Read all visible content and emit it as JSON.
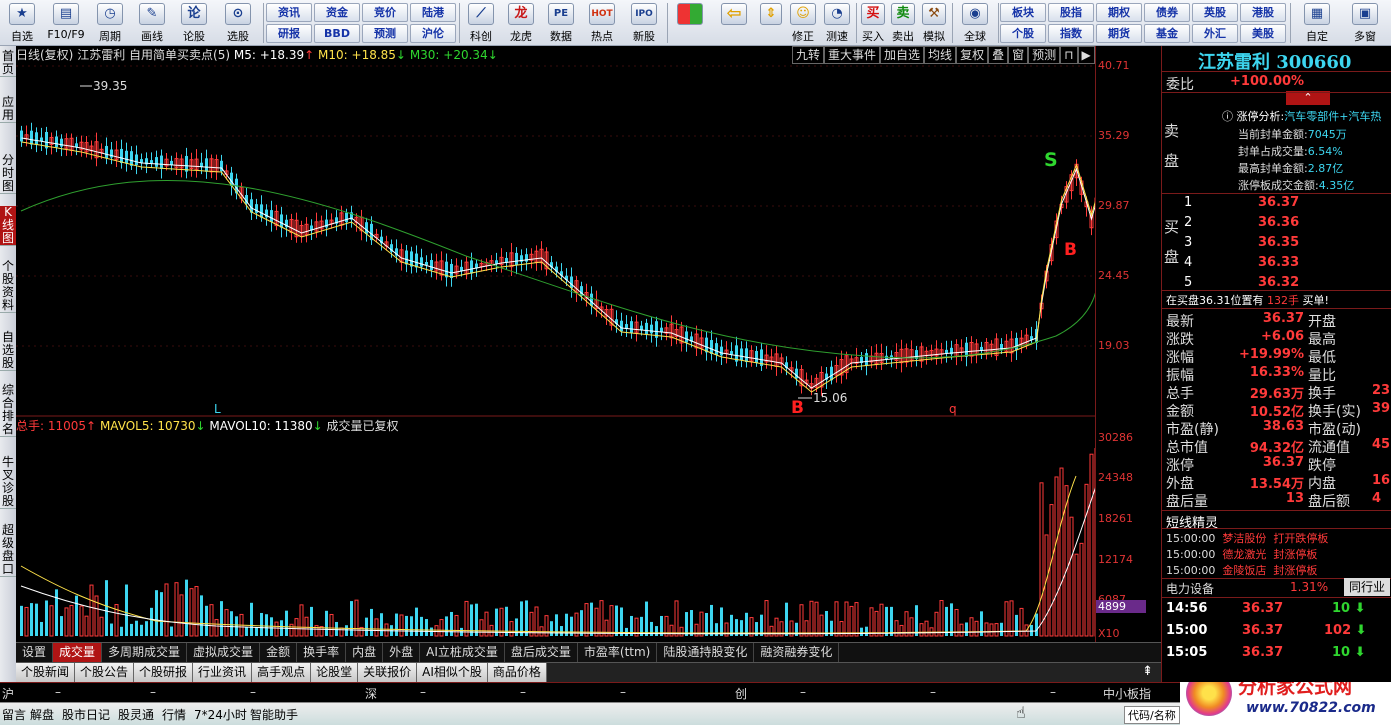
{
  "toolbar": {
    "left": [
      {
        "label": "自选",
        "icon": "star-icon"
      },
      {
        "label": "F10/F9",
        "icon": "f10-icon"
      },
      {
        "label": "周期",
        "icon": "clock-icon"
      },
      {
        "label": "画线",
        "icon": "pencil-icon"
      },
      {
        "label": "论股",
        "icon": "comment-icon"
      },
      {
        "label": "选股",
        "icon": "chart-select-icon"
      }
    ],
    "grid": [
      [
        "资讯",
        "资金",
        "竞价",
        "陆港"
      ],
      [
        "研报",
        "BBD",
        "预测",
        "沪伦"
      ]
    ],
    "mid": [
      {
        "label": "科创",
        "icon": "star-board-icon"
      },
      {
        "label": "龙虎",
        "icon": "dragon-icon"
      },
      {
        "label": "数据",
        "icon": "pe-icon"
      },
      {
        "label": "热点",
        "icon": "hot-icon"
      },
      {
        "label": "新股",
        "icon": "ipo-icon"
      }
    ],
    "right": [
      {
        "label": "修正",
        "icon": "smile-icon"
      },
      {
        "label": "测速",
        "icon": "speed-icon"
      },
      {
        "label": "买入",
        "icon": "buy-icon",
        "glyph": "买"
      },
      {
        "label": "卖出",
        "icon": "sell-icon",
        "glyph": "卖"
      },
      {
        "label": "模拟",
        "icon": "hammer-icon"
      },
      {
        "label": "全球",
        "icon": "globe-icon"
      }
    ],
    "grid2": [
      [
        "板块",
        "股指",
        "期权",
        "债券",
        "英股",
        "港股"
      ],
      [
        "个股",
        "指数",
        "期货",
        "基金",
        "外汇",
        "美股"
      ]
    ],
    "far": [
      {
        "label": "自定",
        "icon": "custom-icon"
      },
      {
        "label": "多窗",
        "icon": "multi-window-icon"
      }
    ]
  },
  "leftnav": [
    "首页",
    "应用",
    "分时图",
    "K线图",
    "个股资料",
    "自选股",
    "综合排名",
    "牛叉诊股",
    "超级盘口"
  ],
  "chart": {
    "header": {
      "title": "日线(复权)",
      "stock": "江苏雷利",
      "indicator": "自用简单买卖点(5)",
      "m5": "M5: +18.39",
      "m10": "M10: +18.85",
      "m30": "M30: +20.34"
    },
    "buttons": [
      "九转",
      "重大事件",
      "加自选",
      "均线",
      "复权",
      "叠",
      "窗",
      "预测"
    ],
    "price_ticks": [
      "40.71",
      "35.29",
      "29.87",
      "24.45",
      "19.03"
    ],
    "vol_ticks": [
      "30286",
      "24348",
      "18261",
      "12174",
      "6087"
    ],
    "vol_current": "4899",
    "vol_unit": "X10",
    "high_label": "39.35",
    "low_label": "15.06",
    "markers": {
      "buy": "B",
      "sell": "S",
      "l": "L",
      "q": "q"
    },
    "vol_header": {
      "label": "总手: 11005",
      "mavol5": "MAVOL5: 10730",
      "mavol10": "MAVOL10: 11380",
      "note": "成交量已复权"
    }
  },
  "tabs1": [
    "设置",
    "成交量",
    "多周期成交量",
    "虚拟成交量",
    "金额",
    "换手率",
    "内盘",
    "外盘",
    "AI立桩成交量",
    "盘后成交量",
    "市盈率(ttm)",
    "陆股通持股变化",
    "融资融券变化"
  ],
  "tabs2": [
    "个股新闻",
    "个股公告",
    "个股研报",
    "行业资讯",
    "高手观点",
    "论股堂",
    "关联报价",
    "AI相似个股",
    "商品价格"
  ],
  "indexbar": {
    "sh": "沪",
    "sz": "深",
    "cy": "创",
    "zx": "中小板指",
    "dash": "–"
  },
  "statusbar": [
    "留言",
    "解盘",
    "股市日记",
    "股灵通",
    "行情",
    "7*24小时",
    "智能助手",
    "代码/名称"
  ],
  "watermark": {
    "text": "分析家公式网",
    "url": "www.70822.com"
  },
  "right": {
    "title": "江苏雷利  300660",
    "weibi_label": "委比",
    "weibi": "+100.00%",
    "limit_title": "涨停分析:",
    "limit_sector": "汽车零部件+汽车热",
    "limit_rows": [
      {
        "k": "当前封单金额:",
        "v": "7045万"
      },
      {
        "k": "封单占成交量:",
        "v": "6.54%"
      },
      {
        "k": "最高封单金额:",
        "v": "2.87亿"
      },
      {
        "k": "涨停板成交金额:",
        "v": "4.35亿"
      }
    ],
    "sell_label": "卖盘",
    "buy_label": "买盘",
    "bids": [
      {
        "n": "1",
        "p": "36.37"
      },
      {
        "n": "2",
        "p": "36.36"
      },
      {
        "n": "3",
        "p": "36.35"
      },
      {
        "n": "4",
        "p": "36.33"
      },
      {
        "n": "5",
        "p": "36.32"
      }
    ],
    "buyline": {
      "text": "在买盘36.31位置有",
      "qty": "132手",
      "tail": "买单!"
    },
    "quote": [
      {
        "k1": "最新",
        "v1": "36.37",
        "k2": "开盘",
        "v2": ""
      },
      {
        "k1": "涨跌",
        "v1": "+6.06",
        "k2": "最高",
        "v2": ""
      },
      {
        "k1": "涨幅",
        "v1": "+19.99%",
        "k2": "最低",
        "v2": ""
      },
      {
        "k1": "振幅",
        "v1": "16.33%",
        "k2": "量比",
        "v2": ""
      },
      {
        "k1": "总手",
        "v1": "29.63万",
        "k2": "换手",
        "v2": "23"
      },
      {
        "k1": "金额",
        "v1": "10.52亿",
        "k2": "换手(实)",
        "v2": "39"
      },
      {
        "k1": "市盈(静)",
        "v1": "38.63",
        "k2": "市盈(动)",
        "v2": ""
      },
      {
        "k1": "总市值",
        "v1": "94.32亿",
        "k2": "流通值",
        "v2": "45"
      },
      {
        "k1": "涨停",
        "v1": "36.37",
        "k2": "跌停",
        "v2": ""
      },
      {
        "k1": "外盘",
        "v1": "13.54万",
        "k2": "内盘",
        "v2": "16"
      },
      {
        "k1": "盘后量",
        "v1": "13",
        "k2": "盘后额",
        "v2": "4"
      }
    ],
    "spirit_title": "短线精灵",
    "spirit": [
      {
        "t": "15:00:00",
        "name": "梦洁股份",
        "ev": "打开跌停板"
      },
      {
        "t": "15:00:00",
        "name": "德龙激光",
        "ev": "封涨停板"
      },
      {
        "t": "15:00:00",
        "name": "金陵饭店",
        "ev": "封涨停板"
      }
    ],
    "industry": {
      "name": "电力设备",
      "chg": "1.31%",
      "btn": "同行业"
    },
    "ticks": [
      {
        "t": "14:56",
        "p": "36.37",
        "v": "10",
        "dir": "down"
      },
      {
        "t": "15:00",
        "p": "36.37",
        "v": "102",
        "dir": "down"
      },
      {
        "t": "15:05",
        "p": "36.37",
        "v": "10",
        "dir": "down"
      }
    ]
  }
}
